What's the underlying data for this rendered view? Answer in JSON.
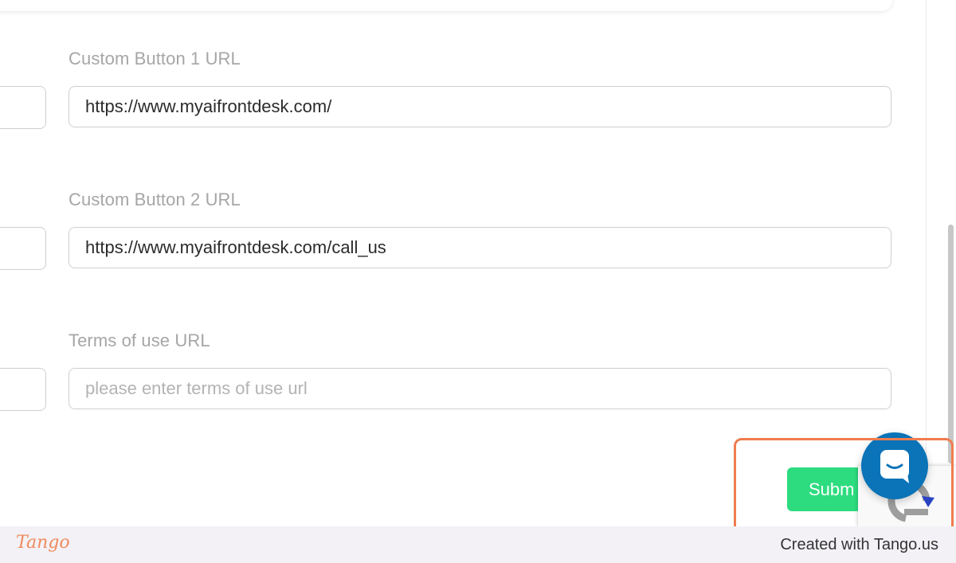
{
  "form": {
    "fields": [
      {
        "label": "Custom Button 1 URL",
        "value": "https://www.myaifrontdesk.com/",
        "placeholder": ""
      },
      {
        "label": "Custom Button 2 URL",
        "value": "https://www.myaifrontdesk.com/call_us",
        "placeholder": ""
      },
      {
        "label": "Terms of use URL",
        "value": "",
        "placeholder": "please enter terms of use url"
      }
    ],
    "submit_label": "Subm"
  },
  "chat_widget": {
    "icon": "chat-bubble-icon",
    "color": "#0b73b7"
  },
  "recaptcha": {
    "icon": "recaptcha-icon"
  },
  "footer": {
    "logo_text": "Tango",
    "created_with": "Created with Tango.us"
  },
  "colors": {
    "submit": "#2ddc7f",
    "highlight": "#f07c4e",
    "footer_bg": "#f3f1f6"
  }
}
